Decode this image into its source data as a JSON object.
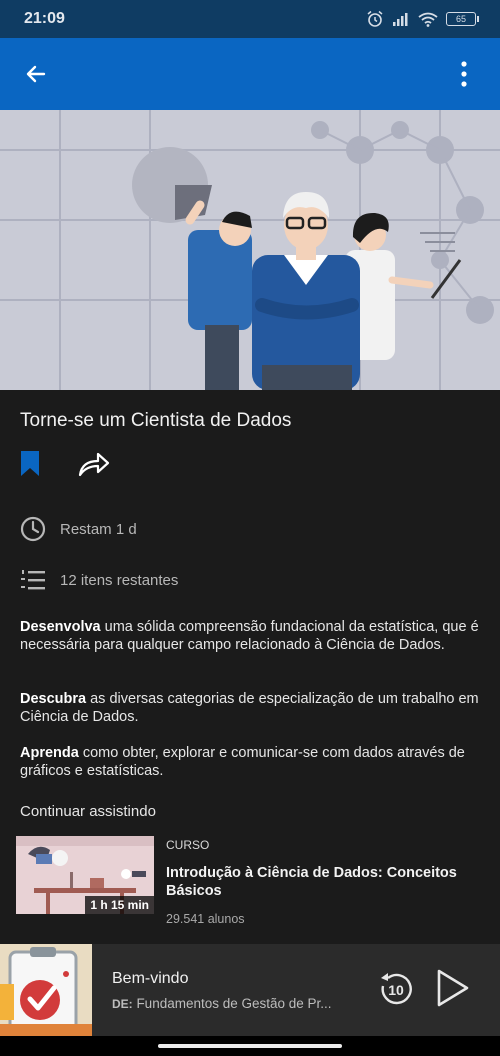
{
  "status_bar": {
    "time": "21:09",
    "battery": "65"
  },
  "course": {
    "title": "Torne-se um Cientista de Dados",
    "time_left": "Restam 1 d",
    "items_left": "12 itens restantes",
    "paragraphs": [
      {
        "lead": "Desenvolva",
        "rest": " uma sólida compreensão fundacional da estatística, que é necessária para qualquer campo relacionado à Ciência de Dados."
      },
      {
        "lead": "Descubra",
        "rest": " as diversas categorias de especialização de um trabalho em Ciência de Dados."
      },
      {
        "lead": "Aprenda",
        "rest": " como obter, explorar e comunicar-se com dados através de gráficos e estatísticas."
      }
    ],
    "continue_label": "Continuar assistindo"
  },
  "card": {
    "type": "CURSO",
    "title": "Introdução à Ciência de Dados: Conceitos Básicos",
    "learners": "29.541 alunos",
    "duration": "1 h 15 min"
  },
  "mini_player": {
    "title": "Bem-vindo",
    "from_label": "DE:",
    "source": "Fundamentos de Gestão de Pr...",
    "rewind_seconds": "10"
  },
  "colors": {
    "accent": "#0a66c2",
    "status_bar": "#0f3c63",
    "background": "#1b1b1b"
  }
}
